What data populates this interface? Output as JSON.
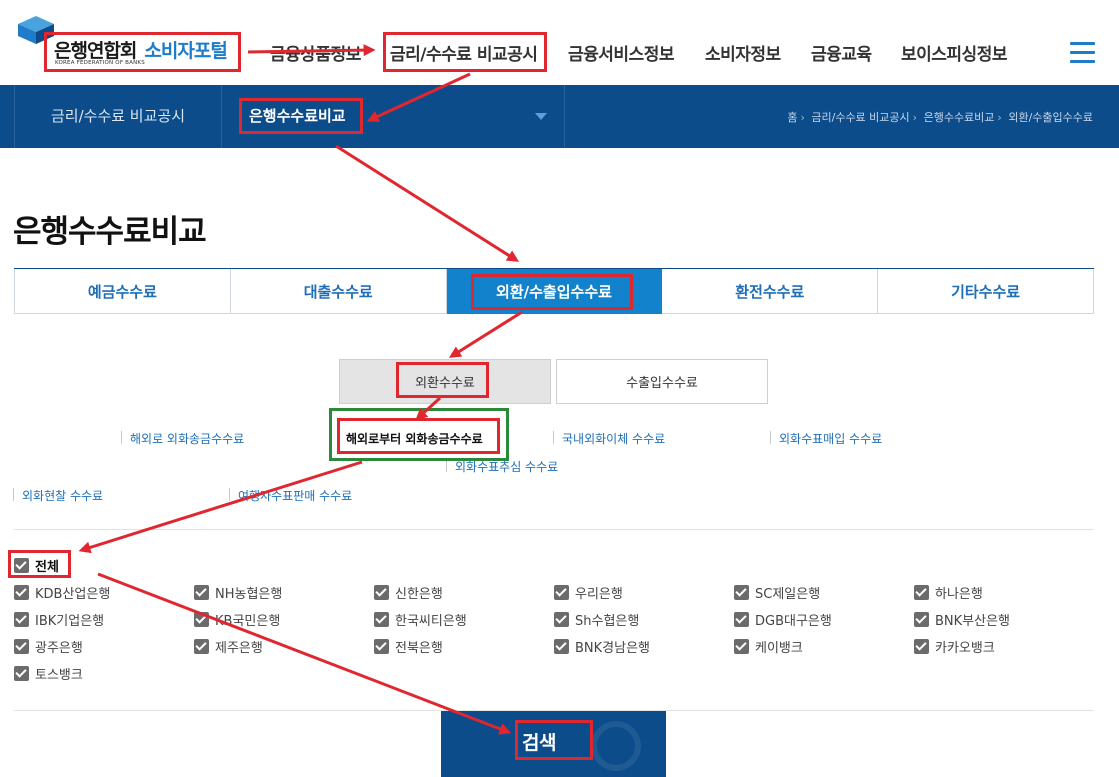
{
  "header": {
    "logo_main": "은행연합회",
    "logo_portal": "소비자포털",
    "logo_sub": "KOREA FEDERATION OF BANKS",
    "menu": [
      "금융상품정보",
      "금리/수수료 비교공시",
      "금융서비스정보",
      "소비자정보",
      "금융교육",
      "보이스피싱정보"
    ]
  },
  "subnav": {
    "section": "금리/수수료 비교공시",
    "current": "은행수수료비교",
    "breadcrumb": [
      "홈",
      "금리/수수료 비교공시",
      "은행수수료비교",
      "외환/수출입수수료"
    ]
  },
  "page": {
    "title": "은행수수료비교"
  },
  "tabs": [
    "예금수수료",
    "대출수수료",
    "외환/수출입수수료",
    "환전수수료",
    "기타수수료"
  ],
  "active_tab": 2,
  "subtabs": [
    "외환수수료",
    "수출입수수료"
  ],
  "fees": [
    "해외로 외화송금수수료",
    "해외로부터 외화송금수수료",
    "국내외화이체 수수료",
    "외화수표매입 수수료",
    "외화수표추심 수수료",
    "외화현찰 수수료",
    "여행자수표판매 수수료"
  ],
  "banks": {
    "all": "전체",
    "list": [
      "KDB산업은행",
      "NH농협은행",
      "신한은행",
      "우리은행",
      "SC제일은행",
      "하나은행",
      "IBK기업은행",
      "KB국민은행",
      "한국씨티은행",
      "Sh수협은행",
      "DGB대구은행",
      "BNK부산은행",
      "광주은행",
      "제주은행",
      "전북은행",
      "BNK경남은행",
      "케이뱅크",
      "카카오뱅크",
      "토스뱅크"
    ]
  },
  "search": {
    "label": "검색"
  },
  "colors": {
    "navy": "#0c4c8a",
    "tab_active": "#1282cc",
    "link": "#1e6fb8",
    "annotation_red": "#e0262e",
    "annotation_green": "#2a8a3a"
  }
}
